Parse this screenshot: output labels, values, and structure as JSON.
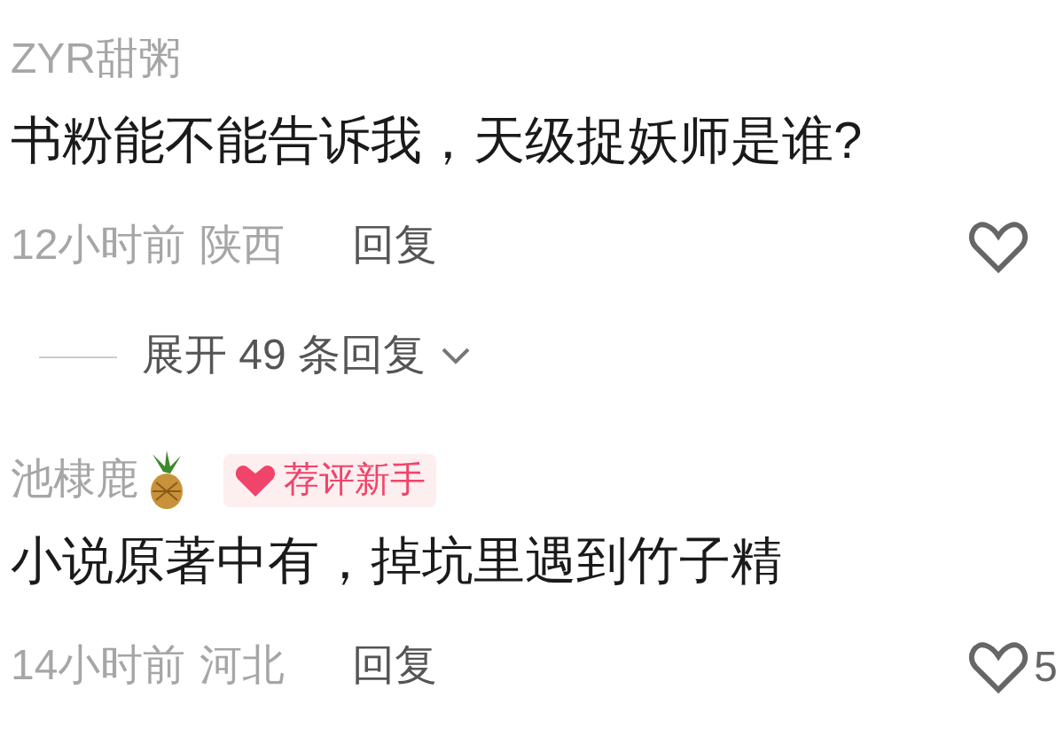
{
  "comments": [
    {
      "username": "ZYR甜粥",
      "text": "书粉能不能告诉我，天级捉妖师是谁?",
      "time": "12小时前",
      "location": "陕西",
      "reply": "回复",
      "expand": "展开 49 条回复"
    },
    {
      "username": "池棣鹿",
      "emoji": true,
      "badge": "荐评新手",
      "text": "小说原著中有，掉坑里遇到竹子精",
      "time": "14小时前",
      "location": "河北",
      "reply": "回复",
      "likes": "5"
    }
  ]
}
